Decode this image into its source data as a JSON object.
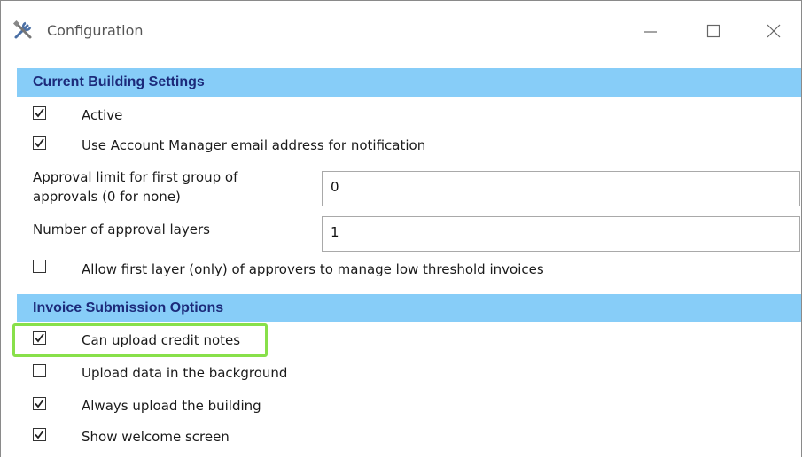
{
  "window": {
    "title": "Configuration",
    "icon": "tools-icon",
    "controls": {
      "minimize": "minimize-icon",
      "maximize": "maximize-icon",
      "close": "close-icon"
    }
  },
  "sections": {
    "building": {
      "header": "Current Building Settings",
      "active": {
        "label": "Active",
        "checked": true
      },
      "use_am_email": {
        "label": "Use Account Manager email address for notification",
        "checked": true
      },
      "approval_limit": {
        "label_line1": "Approval limit for first group of",
        "label_line2": "approvals (0 for none)",
        "value": "0"
      },
      "approval_layers": {
        "label": "Number of approval layers",
        "value": "1"
      },
      "allow_first_layer": {
        "label": "Allow first layer (only) of approvers to manage low threshold invoices",
        "checked": false
      }
    },
    "invoice": {
      "header": "Invoice Submission Options",
      "credit_notes": {
        "label": "Can upload credit notes",
        "checked": true,
        "highlighted": true
      },
      "background_upload": {
        "label": "Upload data in the background",
        "checked": false
      },
      "always_upload_building": {
        "label": "Always upload the building",
        "checked": true
      },
      "welcome_screen": {
        "label": "Show welcome screen",
        "checked": true
      }
    }
  },
  "colors": {
    "section_header_bg": "#87cdf8",
    "section_header_text": "#1c2a7a",
    "highlight": "#88e04a"
  }
}
